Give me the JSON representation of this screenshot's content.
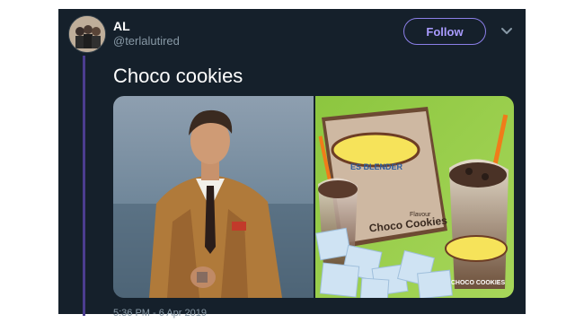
{
  "tweet": {
    "author_name": "AL",
    "author_handle": "@terlalutired",
    "follow_label": "Follow",
    "text": "Choco cookies",
    "timestamp": "5:36 PM - 6 Apr 2019",
    "product_badge": "ES BLENDER",
    "product_flavour": "Flavour",
    "product_name": "Choco Cookies",
    "cup_label": "CHOCO COOKIES"
  },
  "icons": {
    "more": "chevron-down-icon"
  },
  "colors": {
    "background": "#15202b",
    "accent": "#8b7fe8",
    "secondary_text": "#8899a6"
  }
}
